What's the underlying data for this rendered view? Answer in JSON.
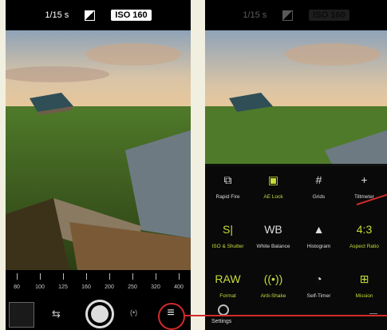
{
  "left_screen": {
    "status": {
      "shutter_speed": "1/15 s",
      "iso": "ISO 160"
    },
    "ruler": {
      "labels": [
        "80",
        "100",
        "125",
        "160",
        "200",
        "250",
        "320",
        "400"
      ]
    },
    "toolbar": {
      "thumbnail": "last-photo",
      "switch": "swap",
      "shutter": "shutter",
      "live": "(•)",
      "menu": "≡"
    }
  },
  "right_screen": {
    "status": {
      "shutter_speed": "1/15 s",
      "iso": "ISO 160"
    },
    "menu_items": [
      {
        "label": "Rapid Fire",
        "icon": "camera-burst-icon",
        "active": false,
        "glyph": "⧉"
      },
      {
        "label": "AE Lock",
        "icon": "lock-icon",
        "active": true,
        "glyph": "▣"
      },
      {
        "label": "Grids",
        "icon": "grid-icon",
        "active": false,
        "glyph": "#"
      },
      {
        "label": "Tiltmeter",
        "icon": "level-icon",
        "active": false,
        "glyph": "+"
      },
      {
        "label": "ISO & Shutter",
        "icon": "iso-shutter-icon",
        "active": true,
        "glyph": "S|"
      },
      {
        "label": "White Balance",
        "icon": "wb-icon",
        "active": false,
        "glyph": "WB"
      },
      {
        "label": "Histogram",
        "icon": "histogram-icon",
        "active": false,
        "glyph": "▲"
      },
      {
        "label": "Aspect Ratio",
        "icon": "aspect-ratio-icon",
        "active": true,
        "glyph": "4:3"
      },
      {
        "label": "Format",
        "icon": "format-icon",
        "active": true,
        "glyph": "RAW"
      },
      {
        "label": "Anti-Shake",
        "icon": "anti-shake-icon",
        "active": true,
        "glyph": "((•))"
      },
      {
        "label": "Self-Timer",
        "icon": "timer-icon",
        "active": false,
        "glyph": "◔"
      },
      {
        "label": "Mission",
        "icon": "mission-icon",
        "active": true,
        "glyph": "⊞"
      }
    ],
    "settings_label": "Settings",
    "close_glyph": "═"
  },
  "colors": {
    "accent": "#c8dc3a",
    "callout": "#d42a2a"
  }
}
